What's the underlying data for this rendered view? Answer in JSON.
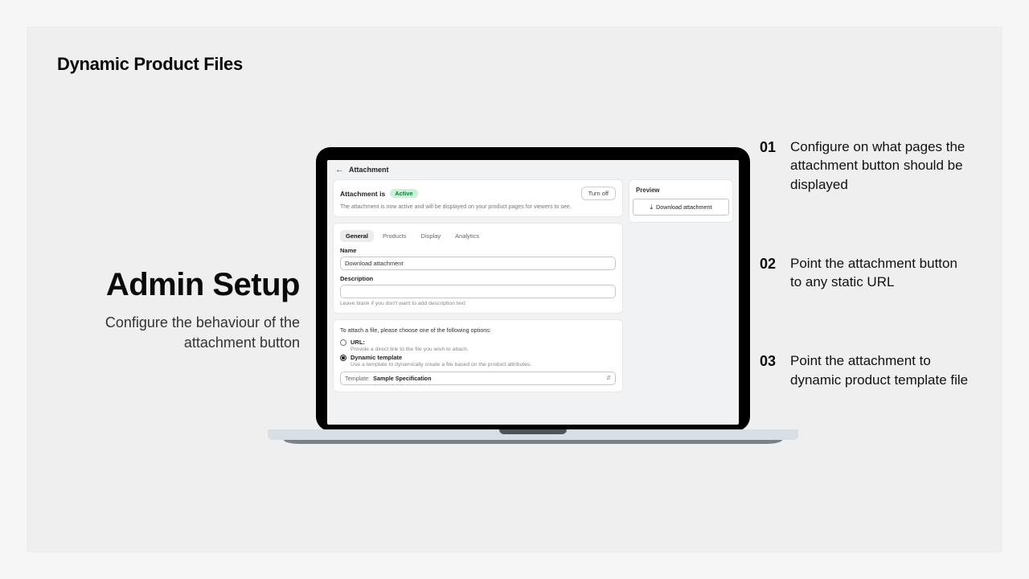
{
  "brand": "Dynamic Product Files",
  "hero": {
    "title": "Admin Setup",
    "subtitle": "Configure the behaviour of the attachment button"
  },
  "steps": [
    {
      "num": "01",
      "text": "Configure on what pages the attachment button should be displayed"
    },
    {
      "num": "02",
      "text": "Point the attachment button to any static URL"
    },
    {
      "num": "03",
      "text": "Point the attachment to dynamic product template file"
    }
  ],
  "app": {
    "page_title": "Attachment",
    "status": {
      "prefix": "Attachment is",
      "badge": "Active",
      "turn_off": "Turn off",
      "desc": "The attachment is now active and will be displayed on your product pages for viewers to see."
    },
    "tabs": [
      "General",
      "Products",
      "Display",
      "Analytics"
    ],
    "active_tab": 0,
    "fields": {
      "name_label": "Name",
      "name_value": "Download attachment",
      "desc_label": "Description",
      "desc_value": "",
      "desc_help": "Leave blank if you don't want to add description text"
    },
    "attach": {
      "lead": "To attach a file, please choose one of the following options:",
      "options": [
        {
          "title": "URL:",
          "desc": "Provide a direct link to the file you wish to attach.",
          "checked": false
        },
        {
          "title": "Dynamic template",
          "desc": "Use a template to dynamically create a file based on the product attributes.",
          "checked": true
        }
      ],
      "template_label": "Template:",
      "template_value": "Sample Specification"
    },
    "preview": {
      "title": "Preview",
      "button": "Download attachment"
    }
  }
}
